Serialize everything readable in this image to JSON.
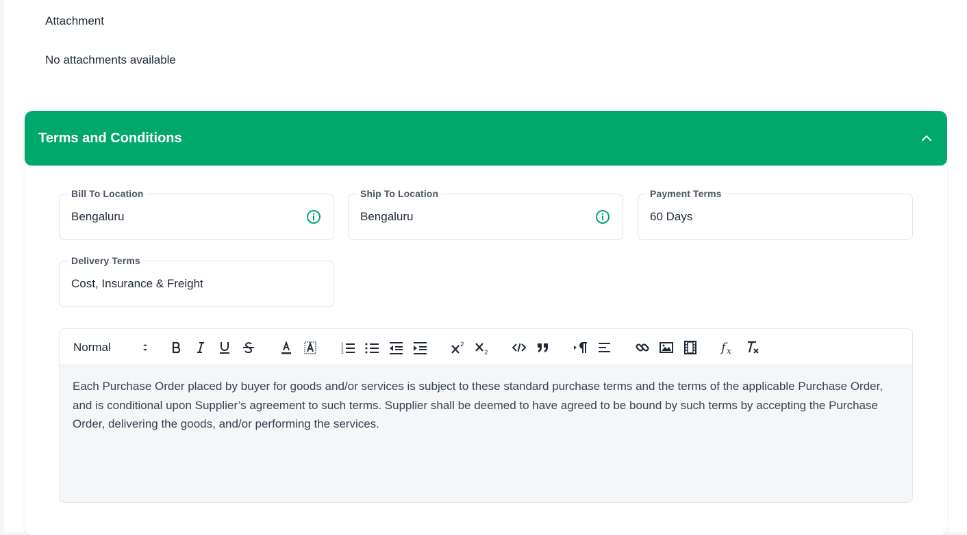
{
  "attachment": {
    "title": "Attachment",
    "empty_text": "No attachments available"
  },
  "terms": {
    "title": "Terms and Conditions",
    "header_color": "#00a86b",
    "fields": {
      "bill_to": {
        "label": "Bill To Location",
        "value": "Bengaluru"
      },
      "ship_to": {
        "label": "Ship To Location",
        "value": "Bengaluru"
      },
      "payment": {
        "label": "Payment Terms",
        "value": "60 Days"
      },
      "delivery": {
        "label": "Delivery Terms",
        "value": "Cost, Insurance & Freight"
      }
    },
    "editor": {
      "format": "Normal",
      "toolbar_icons": [
        "bold-icon",
        "italic-icon",
        "underline-icon",
        "strike-icon",
        "text-color-icon",
        "background-color-icon",
        "ordered-list-icon",
        "bullet-list-icon",
        "outdent-icon",
        "indent-icon",
        "superscript-icon",
        "subscript-icon",
        "code-block-icon",
        "blockquote-icon",
        "text-direction-icon",
        "align-icon",
        "link-icon",
        "image-icon",
        "video-icon",
        "formula-icon",
        "clear-format-icon"
      ],
      "body": "Each Purchase Order placed by buyer for goods and/or services is subject to these standard purchase terms and the terms of the applicable Purchase Order, and is conditional upon Supplier’s agreement to such terms. Supplier shall be deemed to have agreed to be bound by such terms by accepting the Purchase Order, delivering the goods, and/or performing the services."
    }
  }
}
